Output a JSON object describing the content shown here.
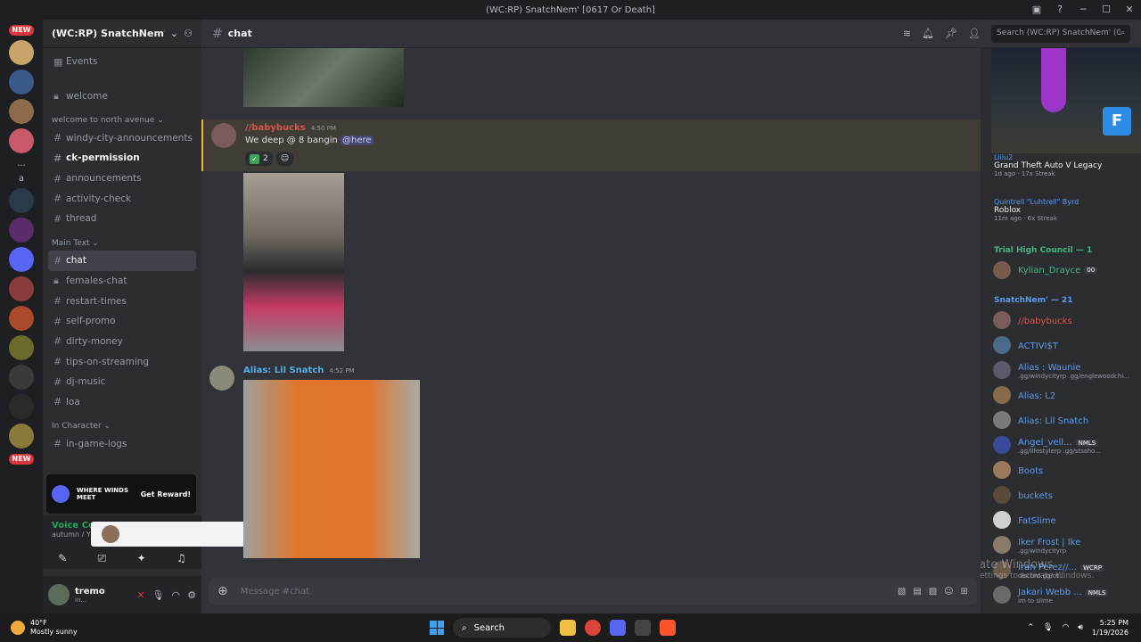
{
  "window": {
    "title": "(WC:RP) SnatchNem' [0617 Or Death]"
  },
  "guilds": {
    "new_badge_top": "NEW",
    "new_badge_bottom": "NEW",
    "more": "...",
    "unread_letter": "a"
  },
  "server": {
    "name": "(WC:RP) SnatchNem' [0..."
  },
  "channels": {
    "events": "Events",
    "welcome": "welcome",
    "cat1": "welcome to north avenue",
    "c1": [
      "windy-city-announcements",
      "ck-permission",
      "announcements",
      "activity-check",
      "thread"
    ],
    "cat2": "Main Text",
    "c2": [
      "chat",
      "females-chat",
      "restart-times",
      "self-promo",
      "dirty-money",
      "tips-on-streaming",
      "dj-music",
      "loa"
    ],
    "cat3": "In Character",
    "c3": [
      "in-game-logs"
    ]
  },
  "promo": {
    "game": "WHERE WINDS MEET",
    "button": "Get Reward!"
  },
  "voice": {
    "title": "Voice Connec...",
    "sub": "autumn / Yves"
  },
  "user": {
    "name": "tremo",
    "status": "in..."
  },
  "chat": {
    "channel": "chat",
    "search_placeholder": "Search (WC:RP) SnatchNem' (06...",
    "composer_placeholder": "Message #chat"
  },
  "messages": [
    {
      "author": "//babybucks",
      "time": "4:50 PM",
      "text": "We deep @ 8 bangin ",
      "mention": "@here",
      "reaction_count": "2",
      "author_color": "#d9534f"
    },
    {
      "author": "Alias: Lil Snatch",
      "time": "4:52 PM",
      "author_color": "#4fb0e8"
    }
  ],
  "members": {
    "activity1": {
      "who": "Liiiu2",
      "game": "Grand Theft Auto V Legacy",
      "meta": "1d ago · 17x Streak"
    },
    "activity2": {
      "who": "Quintrell \"Luhtrell\" Byrd",
      "game": "Roblox",
      "meta": "11m ago · 6x Streak"
    },
    "group1": "Trial High Council — 1",
    "group1_members": [
      {
        "name": "Kylian_Drayce",
        "tag": "00",
        "color": "#43b581"
      }
    ],
    "group2": "SnatchNem' — 21",
    "group2_members": [
      {
        "name": "//babybucks",
        "status": "",
        "color": "#d9534f",
        "tag": ""
      },
      {
        "name": "ACTIVI$T",
        "status": "",
        "color": "#5b9cf0",
        "tag": ""
      },
      {
        "name": "Alias : Waunie",
        "status": ".gg/windycityrp .gg/englewoodchi...",
        "color": "#5b9cf0",
        "tag": ""
      },
      {
        "name": "Alias: L2",
        "status": "",
        "color": "#5b9cf0",
        "tag": ""
      },
      {
        "name": "Alias: Lil Snatch",
        "status": "",
        "color": "#5b9cf0",
        "tag": ""
      },
      {
        "name": "Angel_vell...",
        "status": ".gg/lifestylerp .gg/stssho...",
        "color": "#5b9cf0",
        "tag": "NMLS"
      },
      {
        "name": "Boots",
        "status": "",
        "color": "#5b9cf0",
        "tag": ""
      },
      {
        "name": "buckets",
        "status": "",
        "color": "#5b9cf0",
        "tag": ""
      },
      {
        "name": "FatSlime",
        "status": "",
        "color": "#5b9cf0",
        "tag": ""
      },
      {
        "name": "Iker Frost | Ike",
        "status": ".gg/windycityrp",
        "color": "#5b9cf0",
        "tag": ""
      },
      {
        "name": "Iran Perez//...",
        "status": "discord.gg/ot...",
        "color": "#5b9cf0",
        "tag": "WCRP"
      },
      {
        "name": "Jakari Webb ...",
        "status": "im to slime",
        "color": "#5b9cf0",
        "tag": "NMLS"
      }
    ]
  },
  "watermark": {
    "title": "Activate Windows",
    "sub": "Go to Settings to activate Windows."
  },
  "taskbar": {
    "temp": "40°F",
    "weather": "Mostly sunny",
    "search": "Search",
    "time": "5:25 PM",
    "date": "1/19/2026"
  }
}
